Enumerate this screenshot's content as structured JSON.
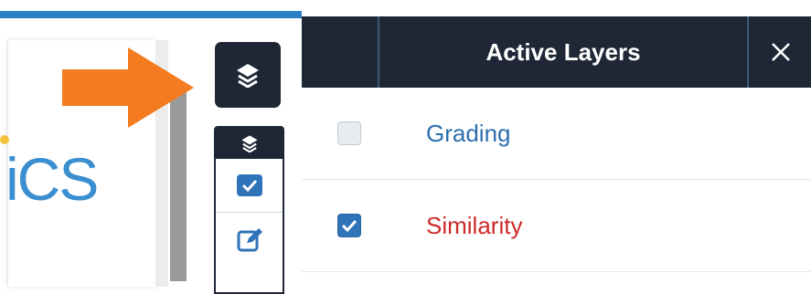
{
  "logo": {
    "text": "iCS"
  },
  "panel": {
    "title": "Active Layers",
    "close_glyph": "✕",
    "layers": [
      {
        "label": "Grading",
        "checked": false,
        "color": "#2c6fae"
      },
      {
        "label": "Similarity",
        "checked": true,
        "color": "#cc2a2a"
      }
    ]
  },
  "icons": {
    "layers_button": "layers-icon",
    "mini_header": "layers-icon",
    "mini_check": "checkbox-icon",
    "mini_edit": "edit-icon",
    "callout": "arrow-right-icon",
    "close": "close-icon"
  },
  "colors": {
    "header_bg": "#1f2737",
    "accent_blue": "#2b7fc7",
    "arrow_orange": "#f47b20",
    "similarity_red": "#cc2a2a",
    "grading_blue": "#2c6fae"
  }
}
